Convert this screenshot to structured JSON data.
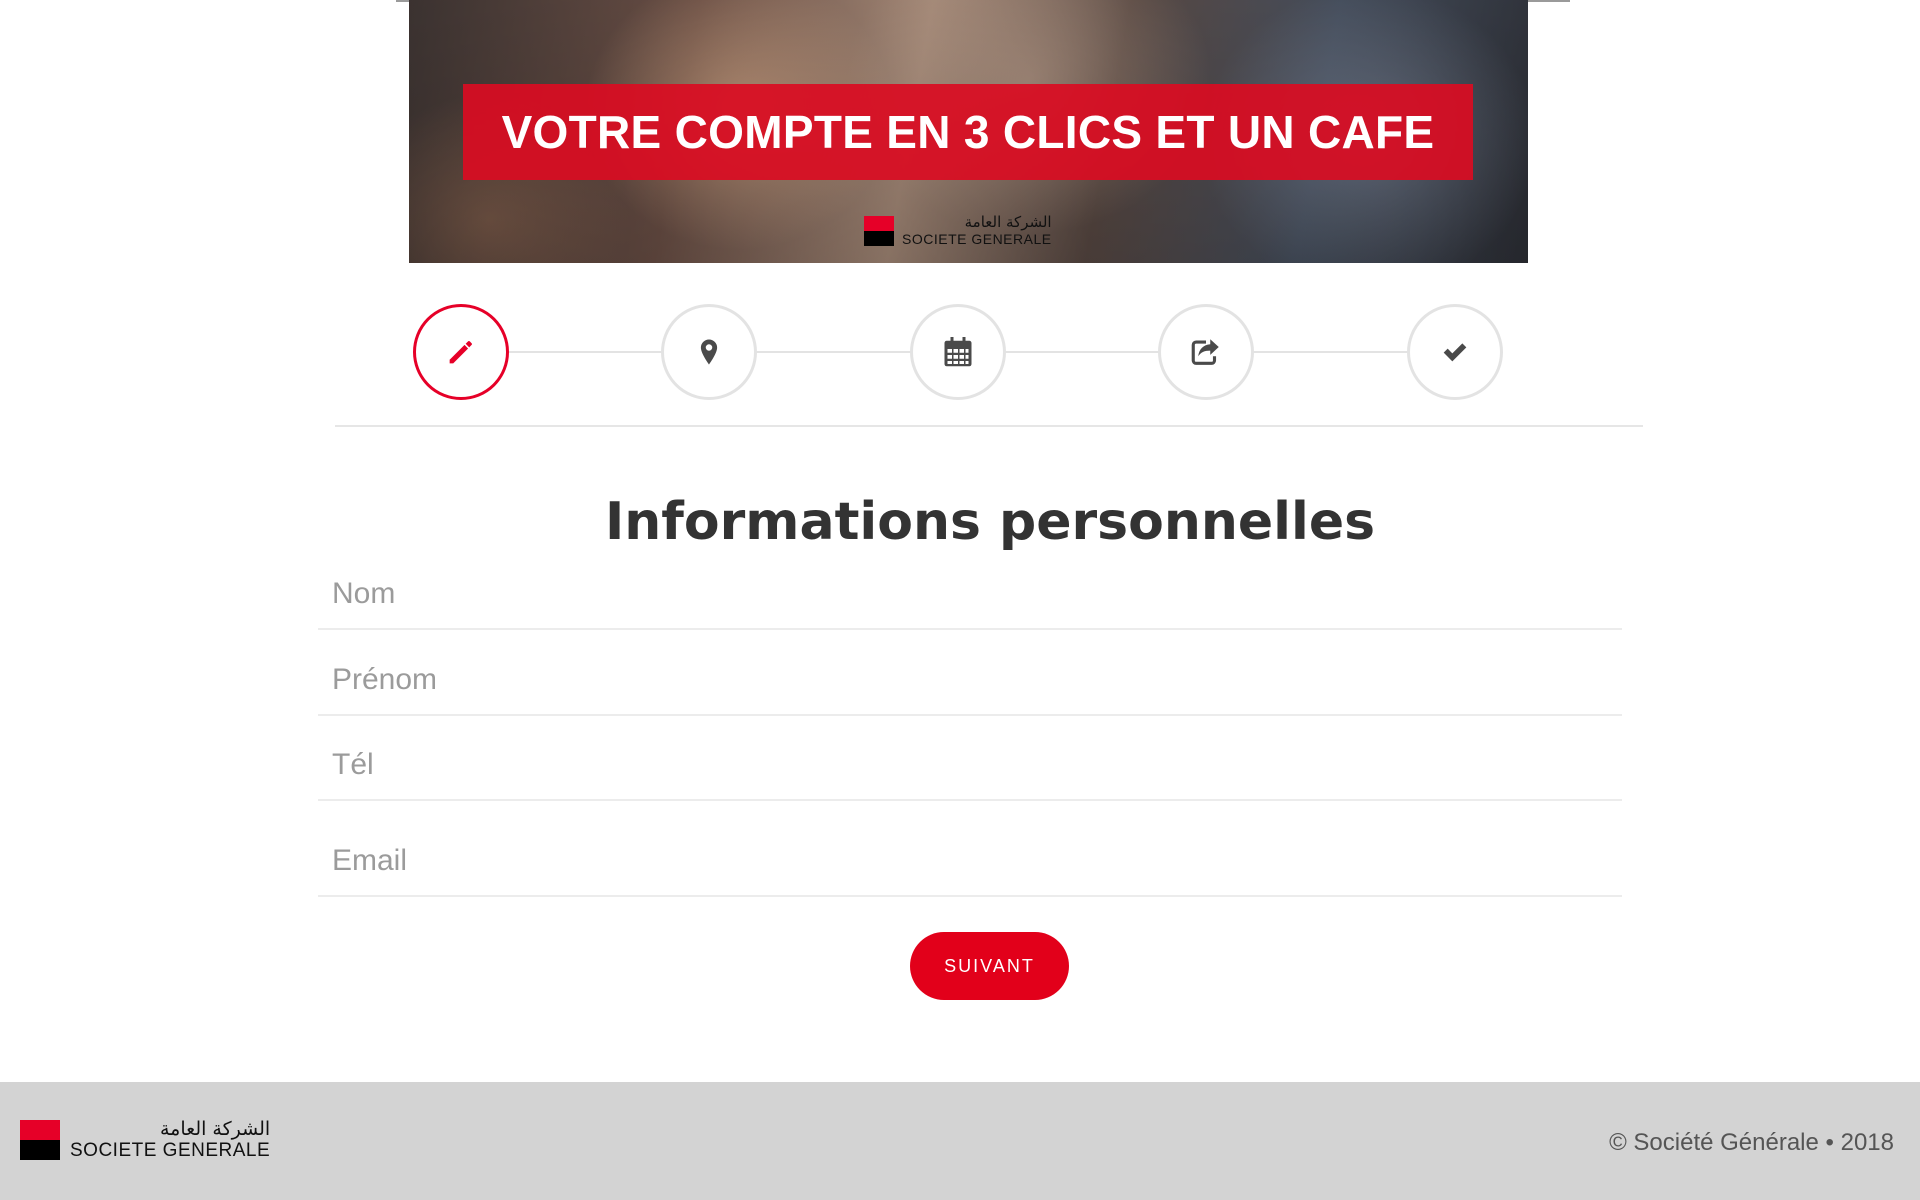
{
  "banner": {
    "headline": "VOTRE COMPTE EN 3 CLICS ET UN CAFE",
    "logo_arabic": "الشركة العامة",
    "logo_name": "SOCIETE GENERALE"
  },
  "stepper": {
    "steps": [
      {
        "icon": "pencil-icon",
        "state": "active"
      },
      {
        "icon": "map-marker-icon",
        "state": "pending"
      },
      {
        "icon": "calendar-icon",
        "state": "pending"
      },
      {
        "icon": "share-icon",
        "state": "pending"
      },
      {
        "icon": "check-icon",
        "state": "pending"
      }
    ],
    "active_color": "#e60028",
    "inactive_color": "#e3e3e3"
  },
  "form": {
    "title": "Informations personnelles",
    "fields": {
      "nom": {
        "placeholder": "Nom",
        "value": ""
      },
      "prenom": {
        "placeholder": "Prénom",
        "value": ""
      },
      "tel": {
        "placeholder": "Tél",
        "value": ""
      },
      "email": {
        "placeholder": "Email",
        "value": ""
      }
    },
    "submit_label": "SUIVANT"
  },
  "footer": {
    "logo_arabic": "الشركة العامة",
    "logo_name": "SOCIETE GENERALE",
    "copyright": "© Société Générale • 2018"
  },
  "colors": {
    "brand_red": "#e2001a",
    "footer_bg": "#d3d3d3",
    "title_text": "#333333",
    "placeholder_text": "#9b9b9b"
  }
}
